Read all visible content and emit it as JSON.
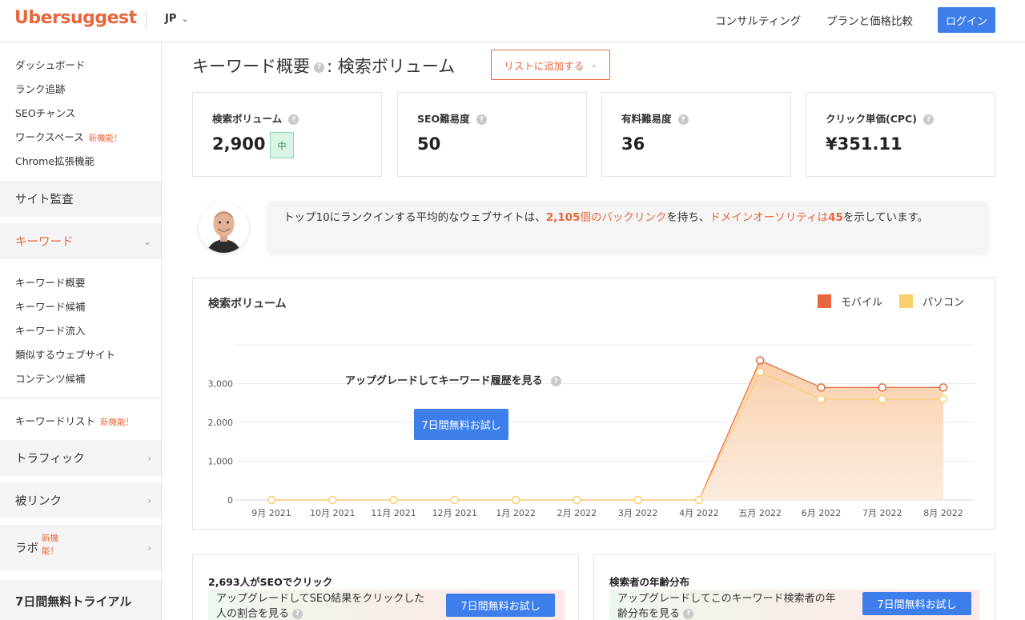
{
  "header": {
    "logo": "Ubersuggest",
    "lang": "JP",
    "nav": [
      "コンサルティング",
      "プランと価格比較"
    ],
    "login": "ログイン"
  },
  "sidebar": {
    "top_items": [
      {
        "label": "ダッシュボード"
      },
      {
        "label": "ランク追跡"
      },
      {
        "label": "SEOチャンス"
      },
      {
        "label": "ワークスペース",
        "badge": "新機能！"
      },
      {
        "label": "Chrome拡張機能"
      }
    ],
    "site_audit": "サイト監査",
    "keywords": "キーワード",
    "keyword_items": [
      "キーワード概要",
      "キーワード候補",
      "キーワード流入",
      "類似するウェブサイト",
      "コンテンツ候補"
    ],
    "keyword_list": "キーワードリスト",
    "keyword_list_badge": "新機能！",
    "traffic": "トラフィック",
    "backlinks": "被リンク",
    "labs": "ラボ",
    "labs_badge_1": "新機",
    "labs_badge_2": "能！",
    "trial": "7日間無料トライアル"
  },
  "main": {
    "title_left": "キーワード概要",
    "title_right": ": 検索ボリューム",
    "add_list": "リストに追加する",
    "metrics": [
      {
        "label": "検索ボリューム",
        "value": "2,900",
        "badge": "中"
      },
      {
        "label": "SEO難易度",
        "value": "50"
      },
      {
        "label": "有料難易度",
        "value": "36"
      },
      {
        "label": "クリック単価(CPC)",
        "value": "¥351.11"
      }
    ],
    "info": {
      "t1": "トップ10にランクインする平均的なウェブサイトは、",
      "backlinks_num": "2,105",
      "backlinks_txt": "個のバックリンク",
      "t2": "を持ち、",
      "da_txt": "ドメインオーソリティは",
      "da_num": "45",
      "t3": "を示しています。"
    },
    "chart_card": {
      "title": "検索ボリューム",
      "upsell": "アップグレードしてキーワード履歴を見る",
      "trial": "7日間無料お試し"
    },
    "bottom_left": {
      "title": "2,693人がSEOでクリック",
      "upsell_1": "アップグレードしてSEO結果をクリックした",
      "upsell_2": "人の割合を見る",
      "trial": "7日間無料お試し"
    },
    "bottom_right": {
      "title": "検索者の年齢分布",
      "upsell_1": "アップグレードしてこのキーワード検索者の年",
      "upsell_2": "齢分布を見る",
      "trial": "7日間無料お試し"
    }
  },
  "colors": {
    "brand": "#e8663d",
    "mobile": "#e8663d",
    "desktop": "#f9cf6e",
    "button": "#3d7eea"
  },
  "chart_data": {
    "type": "area",
    "categories": [
      "9月 2021",
      "10月 2021",
      "11月 2021",
      "12月 2021",
      "1月 2022",
      "2月 2022",
      "3月 2022",
      "4月 2022",
      "五月 2022",
      "6月 2022",
      "7月 2022",
      "8月 2022"
    ],
    "series": [
      {
        "name": "モバイル",
        "color": "#e8663d",
        "values": [
          0,
          0,
          0,
          0,
          0,
          0,
          0,
          0,
          3600,
          2900,
          2900,
          2900
        ]
      },
      {
        "name": "パソコン",
        "color": "#f9cf6e",
        "values": [
          0,
          0,
          0,
          0,
          0,
          0,
          0,
          0,
          3300,
          2600,
          2600,
          2600
        ]
      }
    ],
    "yticks": [
      "0",
      "1,000",
      "2,000",
      "3,000"
    ],
    "ylim": [
      0,
      4000
    ],
    "legend": "top-right"
  }
}
